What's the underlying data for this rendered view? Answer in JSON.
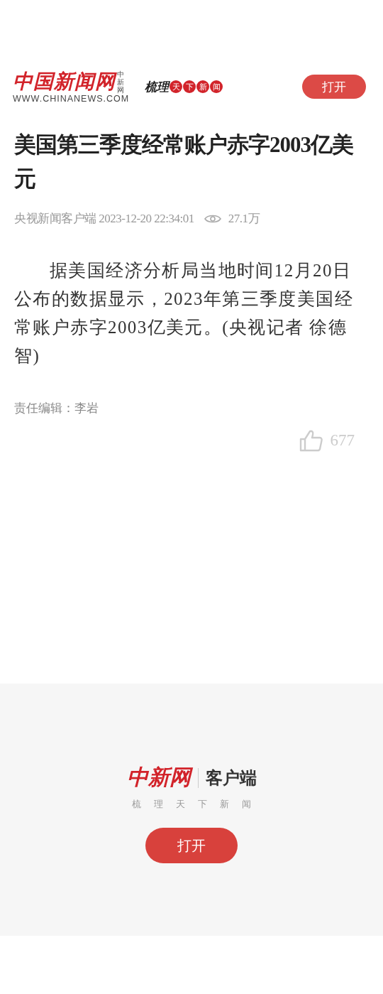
{
  "header": {
    "logo": {
      "name": "中国新闻网",
      "side": "中新网",
      "url": "WWW.CHINANEWS.COM"
    },
    "slogan": {
      "lead": "梳理",
      "seals": [
        "天",
        "下",
        "新",
        "闻"
      ]
    },
    "open_button": "打开"
  },
  "article": {
    "title": "美国第三季度经常账户赤字2003亿美元",
    "source": "央视新闻客户端",
    "time": "2023-12-20 22:34:01",
    "views": "27.1万",
    "body": "据美国经济分析局当地时间12月20日公布的数据显示，2023年第三季度美国经常账户赤字2003亿美元。(央视记者 徐德智)",
    "editor": "责任编辑：李岩",
    "likes": "677"
  },
  "footer": {
    "logo": "中新网",
    "app": "客户端",
    "tagline": [
      "梳",
      "理",
      "天",
      "下",
      "新",
      "闻"
    ],
    "open_button": "打开"
  }
}
